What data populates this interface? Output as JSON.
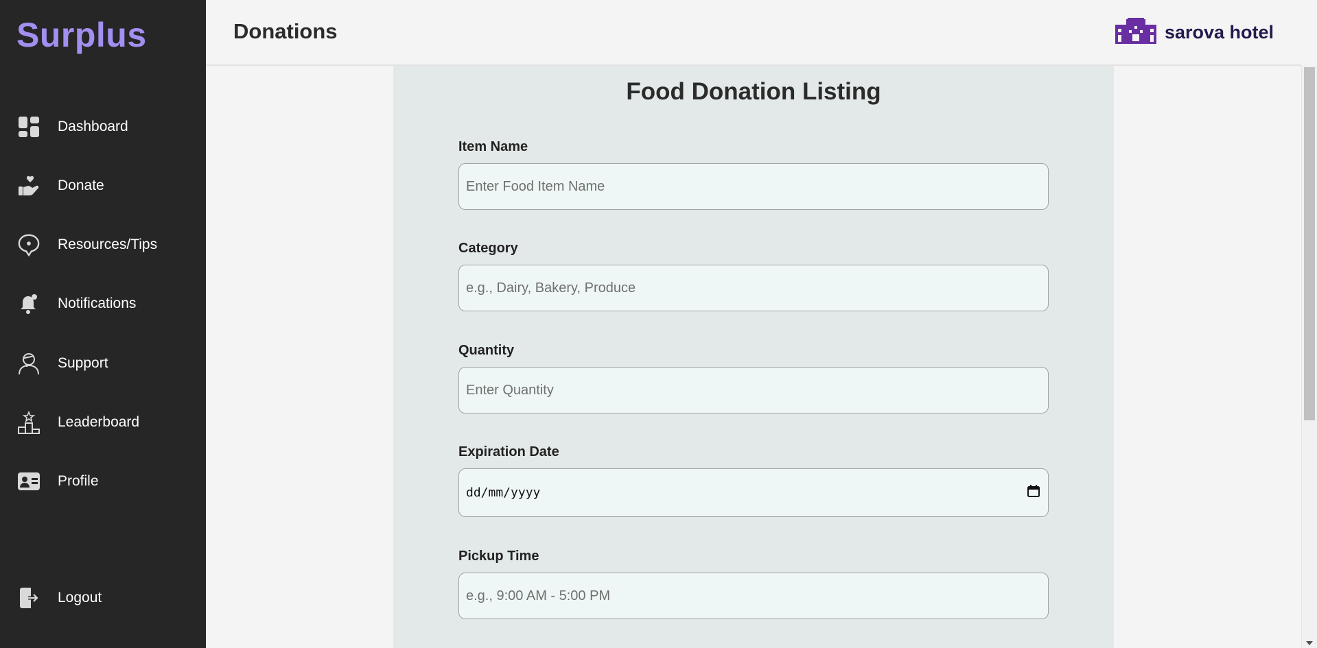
{
  "sidebar": {
    "brand": "Surplus",
    "items": [
      {
        "label": "Dashboard"
      },
      {
        "label": "Donate"
      },
      {
        "label": "Resources/Tips"
      },
      {
        "label": "Notifications"
      },
      {
        "label": "Support"
      },
      {
        "label": "Leaderboard"
      },
      {
        "label": "Profile"
      }
    ],
    "logout": "Logout"
  },
  "header": {
    "title": "Donations",
    "hotel_name": "sarova hotel"
  },
  "form": {
    "title": "Food Donation Listing",
    "fields": [
      {
        "label": "Item Name",
        "placeholder": "Enter Food Item Name",
        "value": ""
      },
      {
        "label": "Category",
        "placeholder": "e.g., Dairy, Bakery, Produce",
        "value": ""
      },
      {
        "label": "Quantity",
        "placeholder": "Enter Quantity",
        "value": ""
      },
      {
        "label": "Expiration Date",
        "placeholder": "dd/mm/yyyy",
        "value": ""
      },
      {
        "label": "Pickup Time",
        "placeholder": "e.g., 9:00 AM - 5:00 PM",
        "value": ""
      }
    ]
  },
  "colors": {
    "brand": "#a38ff0",
    "sidebar_bg": "#262626",
    "hotel_icon": "#6a2ea3",
    "input_bg": "#eef7f5",
    "panel_bg": "#e3e8e8"
  },
  "icons": [
    "dashboard-icon",
    "donate-icon",
    "resources-icon",
    "notifications-icon",
    "support-icon",
    "leaderboard-icon",
    "profile-icon",
    "logout-icon",
    "hotel-icon",
    "calendar-icon"
  ]
}
